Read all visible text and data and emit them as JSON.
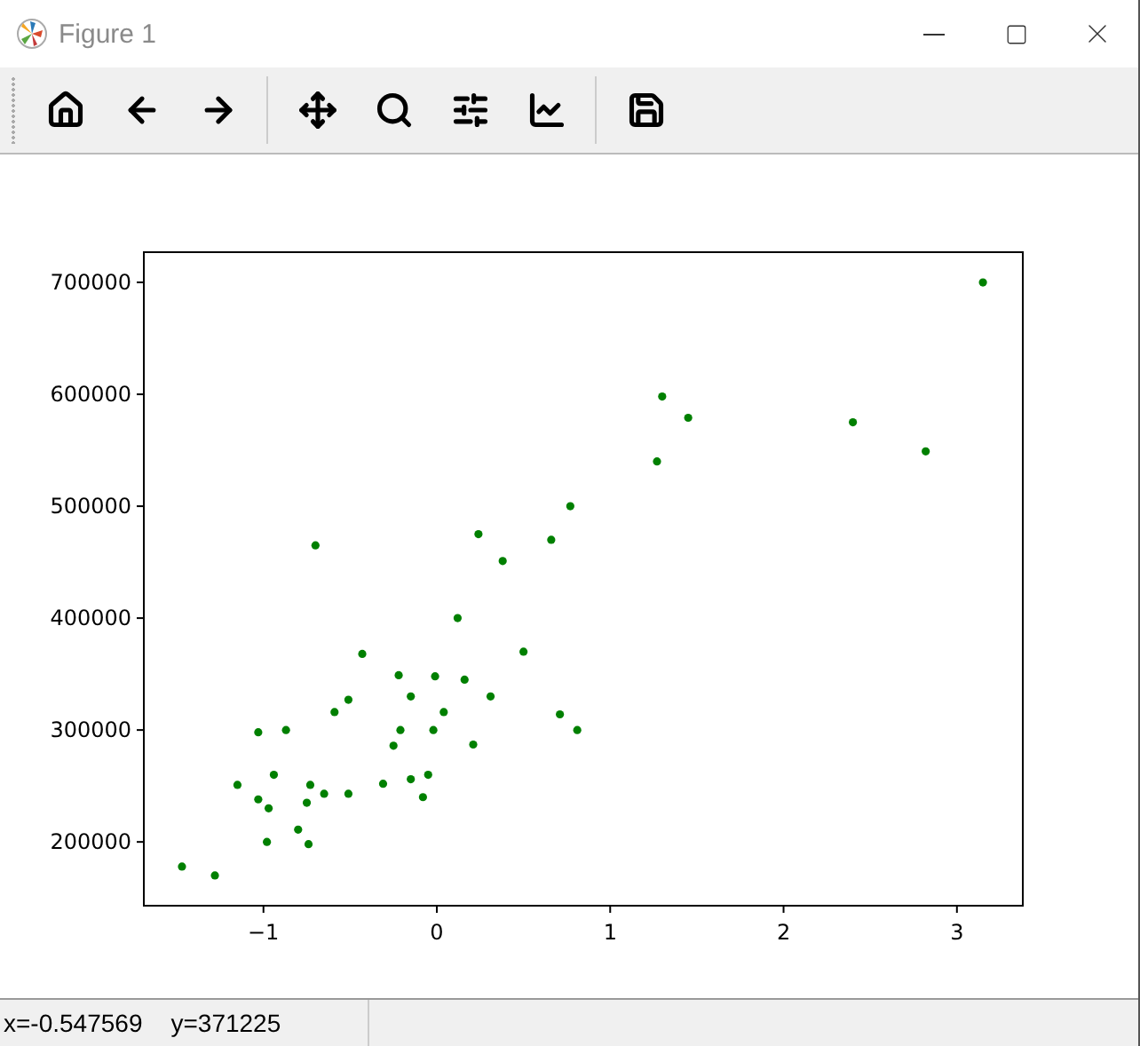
{
  "window": {
    "title": "Figure 1"
  },
  "figure": {
    "chart_data": {
      "type": "scatter",
      "x": [
        -1.47,
        -1.28,
        -1.15,
        -1.03,
        -1.03,
        -0.98,
        -0.97,
        -0.94,
        -0.87,
        -0.8,
        -0.75,
        -0.74,
        -0.73,
        -0.7,
        -0.65,
        -0.59,
        -0.51,
        -0.51,
        -0.43,
        -0.31,
        -0.25,
        -0.22,
        -0.21,
        -0.15,
        -0.15,
        -0.08,
        -0.05,
        -0.02,
        -0.01,
        0.04,
        0.12,
        0.16,
        0.21,
        0.24,
        0.31,
        0.38,
        0.5,
        0.66,
        0.71,
        0.77,
        0.81,
        1.27,
        1.3,
        1.45,
        2.4,
        2.82,
        3.15
      ],
      "series": [
        {
          "color": "#008000",
          "values": [
            178000,
            170000,
            251000,
            298000,
            238000,
            200000,
            230000,
            260000,
            300000,
            211000,
            235000,
            198000,
            251000,
            465000,
            243000,
            316000,
            327000,
            243000,
            368000,
            252000,
            286000,
            349000,
            300000,
            330000,
            256000,
            240000,
            260000,
            300000,
            348000,
            316000,
            400000,
            345000,
            287000,
            475000,
            330000,
            451000,
            370000,
            470000,
            314000,
            500000,
            300000,
            540000,
            598000,
            579000,
            575000,
            549000,
            700000
          ]
        }
      ],
      "xlim": [
        -1.69,
        3.38
      ],
      "ylim": [
        143000,
        727000
      ],
      "xticks": [
        {
          "value": -1,
          "label": "−1"
        },
        0,
        1,
        2,
        3
      ],
      "yticks": [
        200000,
        300000,
        400000,
        500000,
        600000,
        700000
      ]
    }
  },
  "status_bar": {
    "x_reading": "x=-0.547569",
    "y_reading": "y=371225"
  }
}
